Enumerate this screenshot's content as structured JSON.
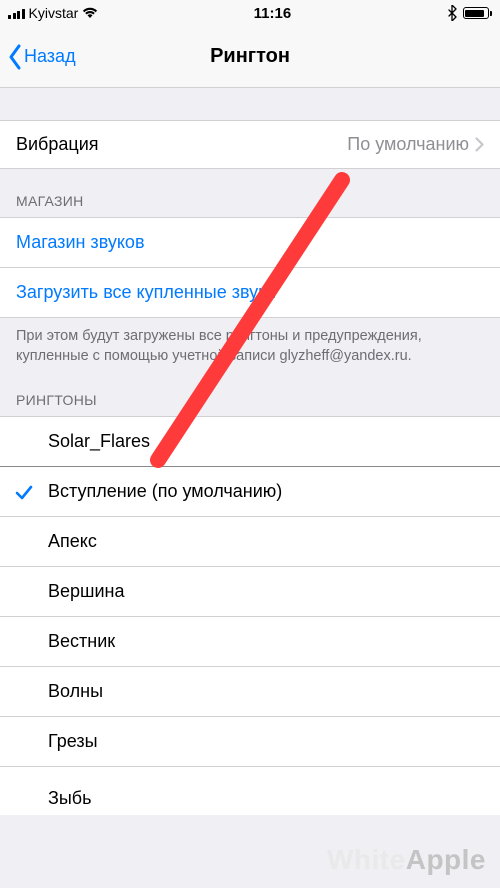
{
  "status": {
    "carrier": "Kyivstar",
    "time": "11:16"
  },
  "nav": {
    "back": "Назад",
    "title": "Рингтон"
  },
  "vibration": {
    "label": "Вибрация",
    "value": "По умолчанию"
  },
  "store": {
    "header": "МАГАЗИН",
    "soundStore": "Магазин звуков",
    "downloadAll": "Загрузить все купленные звуки",
    "footer": "При этом будут загружены все рингтоны и предупреждения, купленные с помощью учетной записи glyzheff@yandex.ru."
  },
  "ringtones": {
    "header": "РИНГТОНЫ",
    "custom": "Solar_Flares",
    "selected": "Вступление (по умолчанию)",
    "items": [
      "Апекс",
      "Вершина",
      "Вестник",
      "Волны",
      "Грезы",
      "Зыбь"
    ]
  },
  "watermark": {
    "part1": "White",
    "part2": "Apple"
  },
  "colors": {
    "arrow": "#ff3a3a"
  }
}
